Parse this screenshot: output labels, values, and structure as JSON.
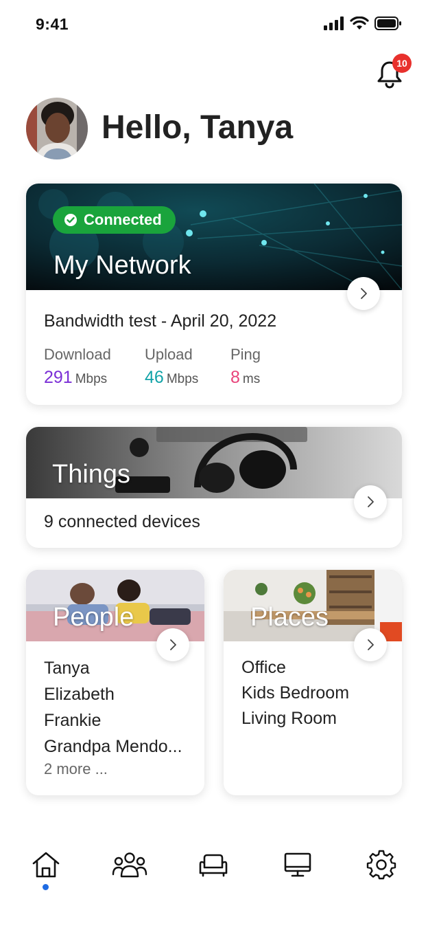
{
  "status_bar": {
    "time": "9:41",
    "icons": [
      "cellular-signal-icon",
      "wifi-icon",
      "battery-icon"
    ]
  },
  "notifications": {
    "icon": "bell-icon",
    "badge_count": "10",
    "badge_color": "#e8312d"
  },
  "header": {
    "greeting": "Hello, Tanya",
    "avatar": "user-avatar"
  },
  "network_card": {
    "status": "Connected",
    "status_icon": "check-circle-icon",
    "status_color": "#1aa43c",
    "title": "My Network",
    "bandwidth_title": "Bandwidth test - April 20, 2022",
    "metrics": [
      {
        "label": "Download",
        "value": "291",
        "unit": "Mbps",
        "color": "#7b2fd6"
      },
      {
        "label": "Upload",
        "value": "46",
        "unit": "Mbps",
        "color": "#12a3a8"
      },
      {
        "label": "Ping",
        "value": "8",
        "unit": "ms",
        "color": "#e8437a"
      }
    ]
  },
  "things_card": {
    "title": "Things",
    "subtitle": "9 connected devices"
  },
  "people_card": {
    "title": "People",
    "items": [
      "Tanya",
      "Elizabeth",
      "Frankie",
      "Grandpa Mendo..."
    ],
    "more": "2 more ..."
  },
  "places_card": {
    "title": "Places",
    "items": [
      "Office",
      "Kids Bedroom",
      "Living Room"
    ]
  },
  "tab_bar": {
    "tabs": [
      {
        "name": "home",
        "icon": "home-icon"
      },
      {
        "name": "people",
        "icon": "people-icon"
      },
      {
        "name": "places",
        "icon": "sofa-icon"
      },
      {
        "name": "devices",
        "icon": "monitor-icon"
      },
      {
        "name": "settings",
        "icon": "gear-icon"
      }
    ],
    "active": "home",
    "active_color": "#1e6be3"
  }
}
